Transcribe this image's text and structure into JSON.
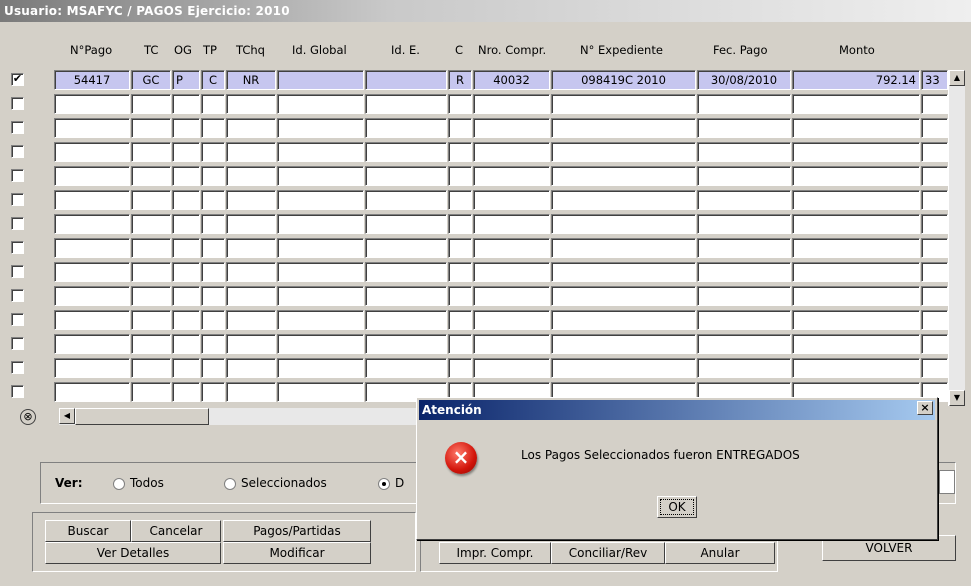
{
  "titlebar": {
    "text": "Usuario: MSAFYC  /  PAGOS  Ejercicio: 2010"
  },
  "columns": {
    "npago": "N°Pago",
    "tc": "TC",
    "og": "OG",
    "tp": "TP",
    "tchq": "TChq",
    "idglobal": "Id. Global",
    "ide": "Id. E.",
    "c": "C",
    "nrocompr": "Nro. Compr.",
    "nexpediente": "N° Expediente",
    "fecpago": "Fec. Pago",
    "monto": "Monto"
  },
  "rows": [
    {
      "checked": "✔",
      "npago": "54417",
      "tc": "GC",
      "og": "P",
      "tp": "C",
      "tchq": "NR",
      "idglobal": "",
      "ide": "",
      "c": "R",
      "nrocompr": "40032",
      "nexpediente": "098419C    2010",
      "fecpago": "30/08/2010",
      "monto": "792.14",
      "extra": "33"
    }
  ],
  "filter": {
    "label": "Ver:",
    "options": [
      "Todos",
      "Seleccionados",
      "D"
    ],
    "selected": "D"
  },
  "buttons": {
    "buscar": "Buscar",
    "cancelar": "Cancelar",
    "pagos_partidas": "Pagos/Partidas",
    "ver_detalles": "Ver Detalles",
    "modificar": "Modificar",
    "impr_compr": "Impr. Compr.",
    "conciliar": "Conciliar/Rev",
    "anular": "Anular",
    "volver": "VOLVER"
  },
  "dialog": {
    "title": "Atención",
    "message": "Los Pagos Seleccionados fueron ENTREGADOS",
    "ok": "OK",
    "close": "×",
    "icon": "error-icon"
  },
  "icons": {
    "clear": "⊗",
    "left": "◀",
    "up": "▲",
    "down": "▼"
  }
}
